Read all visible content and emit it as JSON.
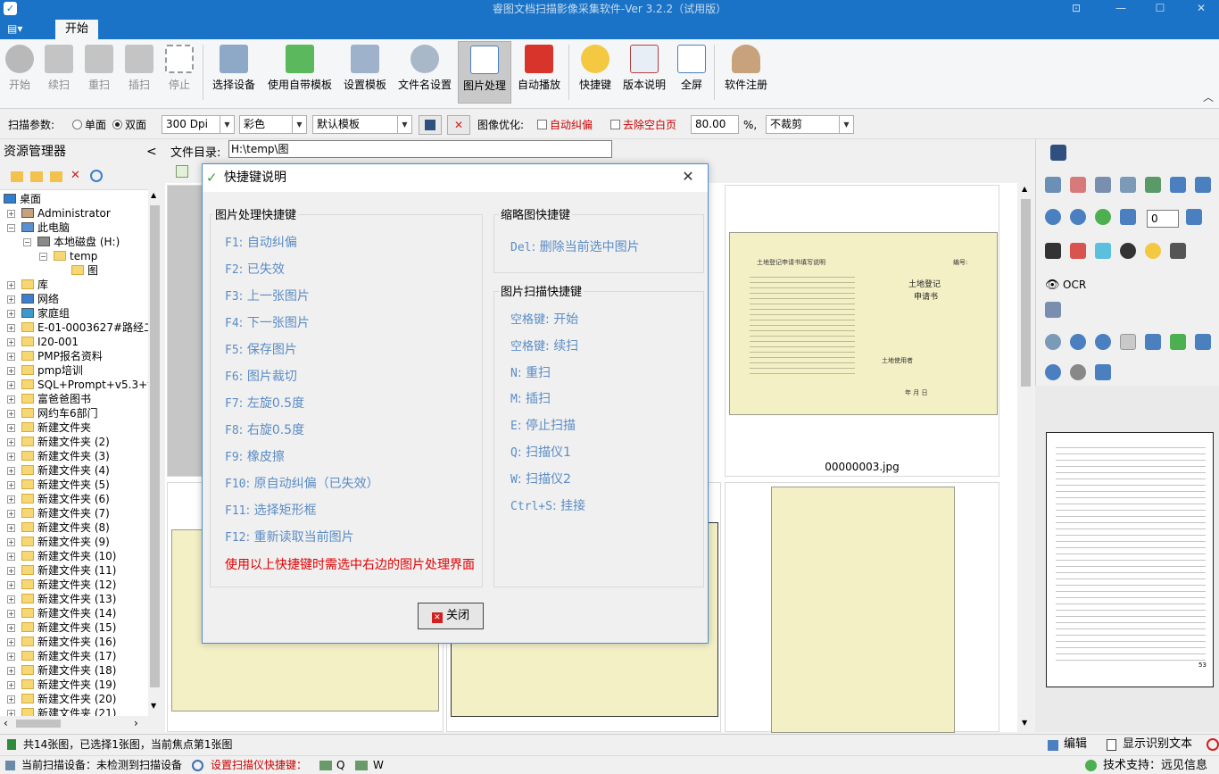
{
  "window": {
    "title": "睿图文档扫描影像采集软件-Ver 3.2.2（试用版）",
    "controls": [
      "⊡",
      "—",
      "☐",
      "✕"
    ]
  },
  "ribbon": {
    "menu_label": "▤▾",
    "tab": "开始",
    "buttons": [
      {
        "label": "开始",
        "disabled": true
      },
      {
        "label": "续扫",
        "disabled": true
      },
      {
        "label": "重扫",
        "disabled": true
      },
      {
        "label": "插扫",
        "disabled": true
      },
      {
        "label": "停止",
        "disabled": true
      },
      {
        "label": "选择设备",
        "disabled": false
      },
      {
        "label": "使用自带模板",
        "disabled": false
      },
      {
        "label": "设置模板",
        "disabled": false
      },
      {
        "label": "文件名设置",
        "disabled": false
      },
      {
        "label": "图片处理",
        "disabled": false,
        "active": true
      },
      {
        "label": "自动播放",
        "disabled": false
      },
      {
        "label": "快捷键",
        "disabled": false
      },
      {
        "label": "版本说明",
        "disabled": false
      },
      {
        "label": "全屏",
        "disabled": false
      },
      {
        "label": "软件注册",
        "disabled": false
      }
    ],
    "collapse": "︿"
  },
  "params": {
    "label": "扫描参数:",
    "mode_single": "单面",
    "mode_double": "双面",
    "dpi": "300 Dpi",
    "color": "彩色",
    "template": "默认模板",
    "optimize_label": "图像优化:",
    "auto_deskew": "自动纠偏",
    "remove_blank": "去除空白页",
    "percent_value": "80.00",
    "percent_unit": "%,",
    "crop": "不裁剪"
  },
  "left": {
    "title": "资源管理器",
    "collapse": "<",
    "tree": [
      {
        "label": "桌面",
        "level": 0,
        "icon": "desktop"
      },
      {
        "label": "Administrator",
        "level": 1,
        "icon": "user"
      },
      {
        "label": "此电脑",
        "level": 1,
        "icon": "pc"
      },
      {
        "label": "本地磁盘 (H:)",
        "level": 2,
        "icon": "drive"
      },
      {
        "label": "temp",
        "level": 3,
        "icon": "folder"
      },
      {
        "label": "图",
        "level": 4,
        "icon": "folder"
      },
      {
        "label": "库",
        "level": 1,
        "icon": "folder"
      },
      {
        "label": "网络",
        "level": 1,
        "icon": "net"
      },
      {
        "label": "家庭组",
        "level": 1,
        "icon": "home"
      },
      {
        "label": "E-01-0003627#路经二",
        "level": 1,
        "icon": "folder"
      },
      {
        "label": "I20-001",
        "level": 1,
        "icon": "folder"
      },
      {
        "label": "PMP报名资料",
        "level": 1,
        "icon": "folder"
      },
      {
        "label": "pmp培训",
        "level": 1,
        "icon": "folder"
      },
      {
        "label": "SQL+Prompt+v5.3+v6",
        "level": 1,
        "icon": "folder"
      },
      {
        "label": "富爸爸图书",
        "level": 1,
        "icon": "folder"
      },
      {
        "label": "网约车6部门",
        "level": 1,
        "icon": "folder"
      },
      {
        "label": "新建文件夹",
        "level": 1,
        "icon": "folder"
      },
      {
        "label": "新建文件夹 (2)",
        "level": 1,
        "icon": "folder"
      },
      {
        "label": "新建文件夹 (3)",
        "level": 1,
        "icon": "folder"
      },
      {
        "label": "新建文件夹 (4)",
        "level": 1,
        "icon": "folder"
      },
      {
        "label": "新建文件夹 (5)",
        "level": 1,
        "icon": "folder"
      },
      {
        "label": "新建文件夹 (6)",
        "level": 1,
        "icon": "folder"
      },
      {
        "label": "新建文件夹 (7)",
        "level": 1,
        "icon": "folder"
      },
      {
        "label": "新建文件夹 (8)",
        "level": 1,
        "icon": "folder"
      },
      {
        "label": "新建文件夹 (9)",
        "level": 1,
        "icon": "folder"
      },
      {
        "label": "新建文件夹 (10)",
        "level": 1,
        "icon": "folder"
      },
      {
        "label": "新建文件夹 (11)",
        "level": 1,
        "icon": "folder"
      },
      {
        "label": "新建文件夹 (12)",
        "level": 1,
        "icon": "folder"
      },
      {
        "label": "新建文件夹 (13)",
        "level": 1,
        "icon": "folder"
      },
      {
        "label": "新建文件夹 (14)",
        "level": 1,
        "icon": "folder"
      },
      {
        "label": "新建文件夹 (15)",
        "level": 1,
        "icon": "folder"
      },
      {
        "label": "新建文件夹 (16)",
        "level": 1,
        "icon": "folder"
      },
      {
        "label": "新建文件夹 (17)",
        "level": 1,
        "icon": "folder"
      },
      {
        "label": "新建文件夹 (18)",
        "level": 1,
        "icon": "folder"
      },
      {
        "label": "新建文件夹 (19)",
        "level": 1,
        "icon": "folder"
      },
      {
        "label": "新建文件夹 (20)",
        "level": 1,
        "icon": "folder"
      },
      {
        "label": "新建文件夹 (21)",
        "level": 1,
        "icon": "folder"
      }
    ]
  },
  "middle": {
    "dir_label": "文件目录:",
    "dir_value": "H:\\temp\\图",
    "thumb_caption": "00000003.jpg",
    "doc_header_left": "土地登记申请书填写说明",
    "doc_title": "土地登记",
    "doc_title2": "申请书",
    "doc_number": "编号:",
    "doc_applicant": "土地使用者",
    "doc_date": "年 月 日"
  },
  "right": {
    "page_input": "0",
    "ocr_label": "OCR",
    "page_number": "53"
  },
  "dialog": {
    "title": "快捷键说明",
    "close_icon": "✕",
    "group_image": "图片处理快捷键",
    "image_shortcuts": [
      {
        "key": "F1",
        "desc": "自动纠偏"
      },
      {
        "key": "F2",
        "desc": "已失效"
      },
      {
        "key": "F3",
        "desc": "上一张图片"
      },
      {
        "key": "F4",
        "desc": "下一张图片"
      },
      {
        "key": "F5",
        "desc": "保存图片"
      },
      {
        "key": "F6",
        "desc": "图片裁切"
      },
      {
        "key": "F7",
        "desc": "左旋0.5度"
      },
      {
        "key": "F8",
        "desc": "右旋0.5度"
      },
      {
        "key": "F9",
        "desc": "橡皮擦"
      },
      {
        "key": "F10",
        "desc": "原自动纠偏（已失效）"
      },
      {
        "key": "F11",
        "desc": "选择矩形框"
      },
      {
        "key": "F12",
        "desc": "重新读取当前图片"
      }
    ],
    "image_note": "使用以上快捷键时需选中右边的图片处理界面",
    "group_thumb": "缩略图快捷键",
    "thumb_shortcuts": [
      {
        "key": "Del",
        "desc": "删除当前选中图片"
      }
    ],
    "group_scan": "图片扫描快捷键",
    "scan_shortcuts": [
      {
        "key": "空格键",
        "desc": "开始"
      },
      {
        "key": "空格键",
        "desc": "续扫"
      },
      {
        "key": "N",
        "desc": "重扫"
      },
      {
        "key": "M",
        "desc": "插扫"
      },
      {
        "key": "E",
        "desc": "停止扫描"
      },
      {
        "key": "Q",
        "desc": "扫描仪1"
      },
      {
        "key": "W",
        "desc": "扫描仪2"
      },
      {
        "key": "Ctrl+S",
        "desc": "挂接"
      }
    ],
    "close_button": "关闭",
    "shortcut_color": "#5b8cc5",
    "note_color": "#e00000"
  },
  "status": {
    "summary": "共14张图，已选择1张图，当前焦点第1张图",
    "edit": "编辑",
    "show_ocr": "显示识别文本",
    "device": "当前扫描设备：未检测到扫描设备",
    "set_hotkey": "设置扫描仪快捷键：",
    "q_label": "Q",
    "w_label": "W",
    "support": "技术支持：远见信息"
  },
  "colors": {
    "titlebar": "#1a73c6",
    "accent_red": "#e00000"
  }
}
